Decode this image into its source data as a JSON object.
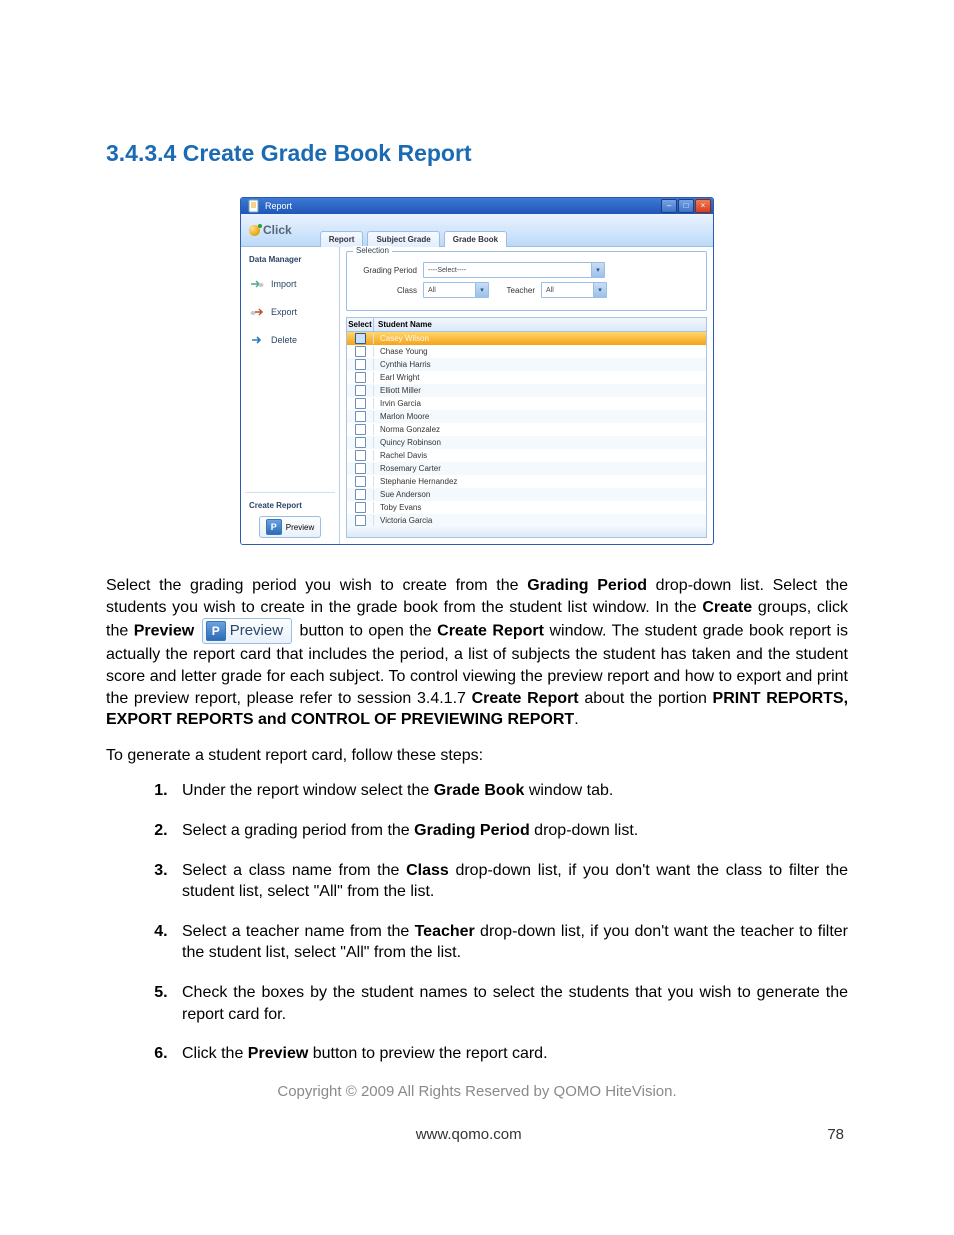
{
  "heading": "3.4.3.4 Create Grade Book Report",
  "window": {
    "title": "Report",
    "logo_text": "Click",
    "tabs": {
      "0": "Report",
      "1": "Subject Grade",
      "2": "Grade Book"
    },
    "sidebar": {
      "group1_label": "Data Manager",
      "import": "Import",
      "export": "Export",
      "delete": "Delete",
      "group2_label": "Create Report",
      "preview": "Preview"
    },
    "selection": {
      "legend": "Selection",
      "grading_period_label": "Grading Period",
      "grading_period_value": "----Select----",
      "class_label": "Class",
      "class_value": "All",
      "teacher_label": "Teacher",
      "teacher_value": "All"
    },
    "grid": {
      "col_select": "Select",
      "col_name": "Student Name",
      "rows": {
        "0": "Casey Wilson",
        "1": "Chase Young",
        "2": "Cynthia Harris",
        "3": "Earl Wright",
        "4": "Elliott Miller",
        "5": "Irvin Garcia",
        "6": "Marlon Moore",
        "7": "Norma Gonzalez",
        "8": "Quincy Robinson",
        "9": "Rachel Davis",
        "10": "Rosemary Carter",
        "11": "Stephanie Hernandez",
        "12": "Sue Anderson",
        "13": "Toby Evans",
        "14": "Victoria Garcia"
      }
    }
  },
  "prose": {
    "p1a": "Select the grading period you wish to create from the ",
    "p1b": "Grading Period",
    "p1c": " drop-down list. Select the students you wish to create in the grade book from the student list window. In the ",
    "p1d": "Create",
    "p1e": " groups, click the ",
    "p1f": "Preview",
    "p1_btn": "Preview",
    "p1g": " button to open the ",
    "p1h": "Create Report",
    "p1i": " window. The student grade book report is actually the report card that includes the period, a list of subjects the student has taken and the student score and letter grade for each subject. To control viewing the preview report and how to export and print the preview report, please refer to session 3.4.1.7 ",
    "p1j": "Create Report",
    "p1k": " about the portion ",
    "p1l": "PRINT REPORTS, EXPORT REPORTS and CONTROL OF PREVIEWING REPORT",
    "p1m": ".",
    "p2": "To generate a student report card, follow these steps:"
  },
  "steps": {
    "s1a": "Under the report window select the ",
    "s1b": "Grade Book",
    "s1c": " window tab.",
    "s2a": "Select a grading period from the ",
    "s2b": "Grading Period",
    "s2c": " drop-down list.",
    "s3a": "Select a class name from the ",
    "s3b": "Class",
    "s3c": " drop-down list, if you don't want the class to filter the student list, select \"All\" from the list.",
    "s4a": "Select a teacher name from the ",
    "s4b": "Teacher",
    "s4c": " drop-down list, if you don't want the teacher to filter the student list, select \"All\" from the list.",
    "s5": "Check the boxes by the student names to select the students that you wish to generate the report card for.",
    "s6a": "Click the ",
    "s6b": "Preview",
    "s6c": " button to preview the report card."
  },
  "copyright": "Copyright © 2009 All Rights Reserved by QOMO HiteVision.",
  "footer_url": "www.qomo.com",
  "page_number": "78"
}
